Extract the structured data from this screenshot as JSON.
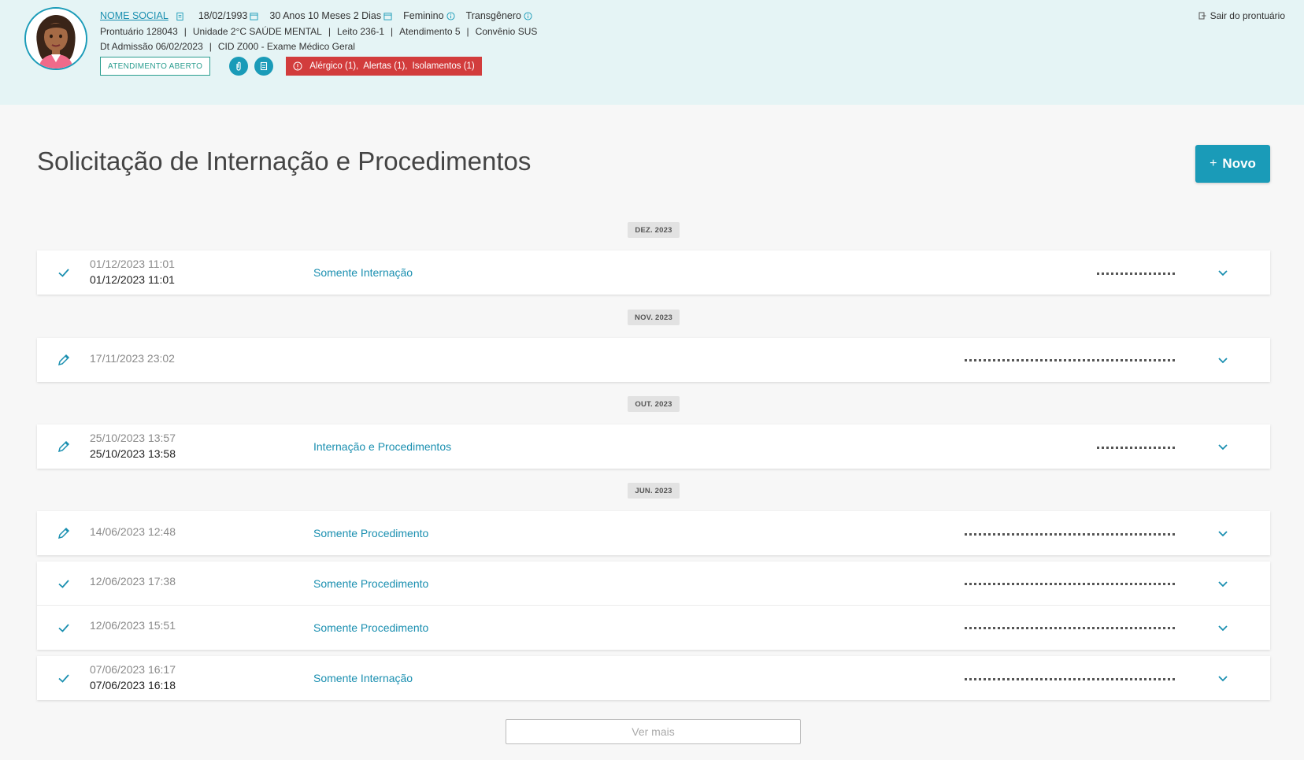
{
  "header": {
    "nome_social": "NOME SOCIAL",
    "birth_date": "18/02/1993",
    "age": "30 Anos 10 Meses 2 Dias",
    "gender": "Feminino",
    "identity": "Transgênero",
    "prontuario": "Prontuário 128043",
    "unidade": "Unidade 2°C SAÚDE MENTAL",
    "leito": "Leito 236-1",
    "atendimento": "Atendimento 5",
    "convenio": "Convênio SUS",
    "admissao": "Dt Admissão 06/02/2023",
    "cid": "CID Z000 - Exame Médico Geral",
    "status_badge": "ATENDIMENTO ABERTO",
    "alerts": {
      "alergico": "Alérgico (1),",
      "alertas": "Alertas (1),",
      "isolamentos": "Isolamentos (1)"
    },
    "logout_label": "Sair do prontuário"
  },
  "page": {
    "title": "Solicitação de Internação e Procedimentos",
    "new_button_label": "Novo",
    "ver_mais_label": "Ver mais"
  },
  "groups": [
    {
      "month": "DEZ. 2023",
      "items": [
        {
          "status": "done",
          "date1": "01/12/2023 11:01",
          "date2": "01/12/2023 11:01",
          "type": "Somente Internação"
        }
      ]
    },
    {
      "month": "NOV. 2023",
      "items": [
        {
          "status": "edit",
          "date1": "17/11/2023 23:02",
          "date2": "",
          "type": ""
        }
      ]
    },
    {
      "month": "OUT. 2023",
      "items": [
        {
          "status": "edit",
          "date1": "25/10/2023 13:57",
          "date2": "25/10/2023 13:58",
          "type": "Internação e Procedimentos"
        }
      ]
    },
    {
      "month": "JUN. 2023",
      "items": [
        {
          "status": "edit",
          "date1": "14/06/2023 12:48",
          "date2": "",
          "type": "Somente Procedimento"
        },
        {
          "status": "done",
          "date1": "12/06/2023 17:38",
          "date2": "",
          "type": "Somente Procedimento"
        },
        {
          "status": "done",
          "date1": "12/06/2023 15:51",
          "date2": "",
          "type": "Somente Procedimento"
        },
        {
          "status": "done",
          "date1": "07/06/2023 16:17",
          "date2": "07/06/2023 16:18",
          "type": "Somente Internação"
        }
      ]
    }
  ],
  "colors": {
    "accent": "#1a9bb8",
    "header_bg": "#e5f4f5",
    "alert_red": "#d23c3c",
    "badge_green": "#2a9d8f"
  }
}
